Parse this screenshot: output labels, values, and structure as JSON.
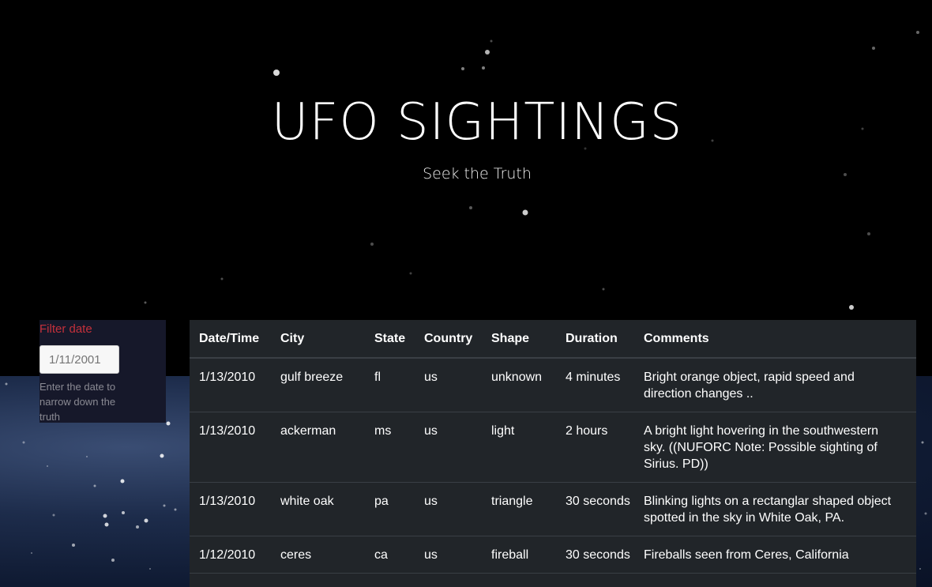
{
  "header": {
    "title": "UFO SIGHTINGS",
    "subtitle": "Seek the Truth"
  },
  "filter": {
    "label": "Filter date",
    "placeholder": "1/11/2001",
    "help": "Enter the date to narrow down the truth"
  },
  "table": {
    "columns": [
      "Date/Time",
      "City",
      "State",
      "Country",
      "Shape",
      "Duration",
      "Comments"
    ],
    "rows": [
      [
        "1/13/2010",
        "gulf breeze",
        "fl",
        "us",
        "unknown",
        "4 minutes",
        "Bright orange object, rapid speed and direction changes .."
      ],
      [
        "1/13/2010",
        "ackerman",
        "ms",
        "us",
        "light",
        "2 hours",
        "A bright light hovering in the southwestern sky. ((NUFORC Note: Possible sighting of Sirius. PD))"
      ],
      [
        "1/13/2010",
        "white oak",
        "pa",
        "us",
        "triangle",
        "30 seconds",
        "Blinking lights on a rectanglar shaped object spotted in the sky in White Oak, PA."
      ],
      [
        "1/12/2010",
        "ceres",
        "ca",
        "us",
        "fireball",
        "30 seconds",
        "Fireballs seen from Ceres, California"
      ]
    ]
  },
  "colors": {
    "filter_label": "#c3303b",
    "table_bg": "#212529",
    "hero_bg": "#000000"
  }
}
